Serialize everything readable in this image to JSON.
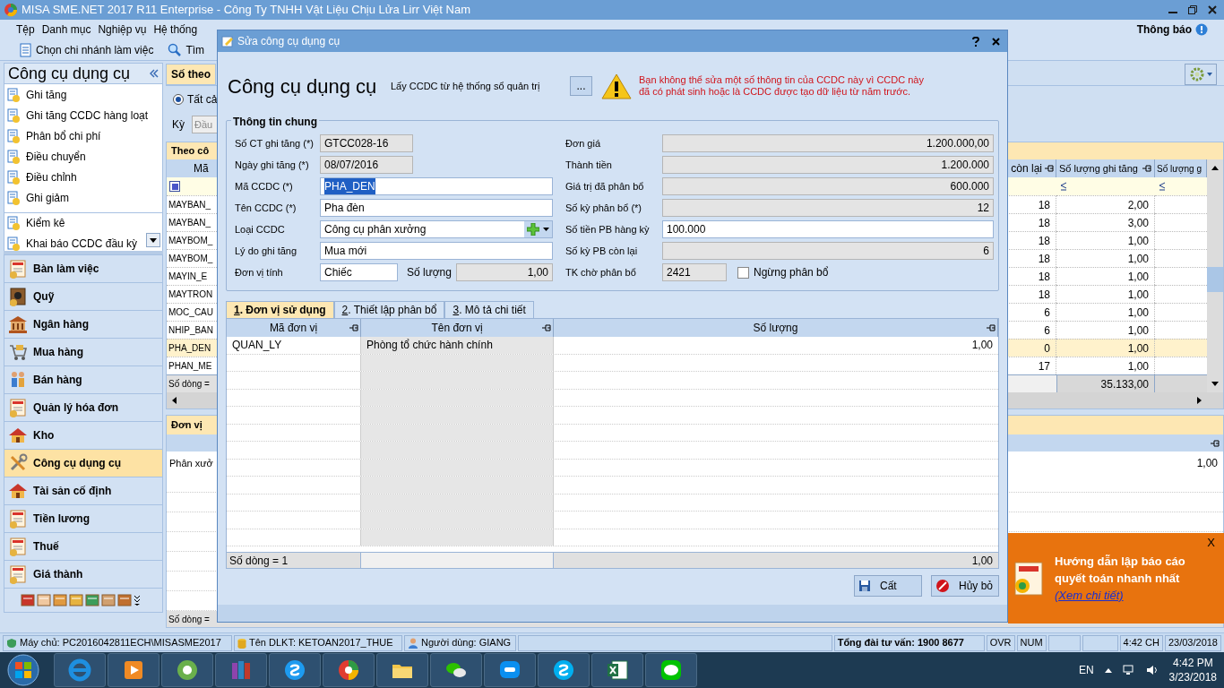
{
  "window": {
    "title": "MISA SME.NET 2017 R11 Enterprise - Công Ty TNHH Vật Liệu Chịu Lửa Lirr Việt Nam"
  },
  "menu": [
    "Tệp",
    "Danh mục",
    "Nghiệp vụ",
    "Hệ thống"
  ],
  "notification_button": "Thông báo",
  "toolbar": [
    {
      "label": "Chọn chi nhánh làm việc",
      "kind": "doc"
    },
    {
      "label": "Tìm",
      "kind": "search"
    }
  ],
  "sidebar": {
    "title": "Công cụ dụng cụ",
    "tasks": [
      {
        "label": "Ghi tăng"
      },
      {
        "label": "Ghi tăng CCDC hàng loạt"
      },
      {
        "label": "Phân bổ chi phí"
      },
      {
        "label": "Điều chuyển"
      },
      {
        "label": "Điều chỉnh"
      },
      {
        "label": "Ghi giảm"
      },
      {
        "label": "Kiểm kê"
      },
      {
        "label": "Khai báo CCDC đầu kỳ"
      }
    ],
    "modules": [
      {
        "label": "Bàn làm việc",
        "kind": "doc",
        "selected": false
      },
      {
        "label": "Quỹ",
        "kind": "safe",
        "selected": false
      },
      {
        "label": "Ngân hàng",
        "kind": "bank",
        "selected": false
      },
      {
        "label": "Mua hàng",
        "kind": "cart",
        "selected": false
      },
      {
        "label": "Bán hàng",
        "kind": "people",
        "selected": false
      },
      {
        "label": "Quản lý hóa đơn",
        "kind": "doc",
        "selected": false
      },
      {
        "label": "Kho",
        "kind": "house",
        "selected": false
      },
      {
        "label": "Công cụ dụng cụ",
        "kind": "tools",
        "selected": true
      },
      {
        "label": "Tài sản cố định",
        "kind": "house",
        "selected": false
      },
      {
        "label": "Tiền lương",
        "kind": "doc",
        "selected": false
      },
      {
        "label": "Thuế",
        "kind": "doc",
        "selected": false
      },
      {
        "label": "Giá thành",
        "kind": "doc",
        "selected": false
      }
    ]
  },
  "main": {
    "tab": "Số theo",
    "radio": {
      "label": "Tất cả",
      "selected": true
    },
    "period_label": "Kỳ",
    "period_value": "Đầu",
    "grid": {
      "group": "Theo cô",
      "filter_checked": true,
      "columns": [
        "Mã",
        "còn lại",
        "Số lượng ghi tăng",
        "Số lượng g"
      ],
      "rows": [
        {
          "code": "MAYBAN_",
          "remaining": "18",
          "qty": "2,00",
          "selected": false
        },
        {
          "code": "MAYBAN_",
          "remaining": "18",
          "qty": "3,00",
          "selected": false
        },
        {
          "code": "MAYBOM_",
          "remaining": "18",
          "qty": "1,00",
          "selected": false
        },
        {
          "code": "MAYBOM_",
          "remaining": "18",
          "qty": "1,00",
          "selected": false
        },
        {
          "code": "MAYIN_E",
          "remaining": "18",
          "qty": "1,00",
          "selected": false
        },
        {
          "code": "MAYTRON",
          "remaining": "18",
          "qty": "1,00",
          "selected": false
        },
        {
          "code": "MOC_CAU",
          "remaining": "6",
          "qty": "1,00",
          "selected": false
        },
        {
          "code": "NHIP_BAN",
          "remaining": "6",
          "qty": "1,00",
          "selected": false
        },
        {
          "code": "PHA_DEN",
          "remaining": "0",
          "qty": "1,00",
          "selected": true
        },
        {
          "code": "PHAN_ME",
          "remaining": "17",
          "qty": "1,00",
          "selected": false
        }
      ],
      "footer": "Số dòng =",
      "total": "35.133,00"
    },
    "units_grid": {
      "group": "Đơn vị",
      "rows": [
        {
          "name": "Phân xưở",
          "qty": "1,00"
        }
      ],
      "footer": "Số dòng ="
    }
  },
  "dialog": {
    "title": "Sửa công cụ dụng cụ",
    "heading": "Công cụ dụng cụ",
    "source_label": "Lấy CCDC từ hệ thống sổ quản trị",
    "browse_button": "...",
    "warning": "Bạn không thể sửa một số thông tin của CCDC này vì CCDC này đã có phát sinh hoặc là CCDC được tạo dữ liệu từ năm trước.",
    "group": "Thông tin chung",
    "left_fields": [
      {
        "label": "Số CT ghi tăng (*)",
        "value": "GTCC028-16",
        "kind": "readonly-short"
      },
      {
        "label": "Ngày ghi tăng (*)",
        "value": "08/07/2016",
        "kind": "readonly-short"
      },
      {
        "label": "Mã CCDC (*)",
        "value": "PHA_DEN",
        "kind": "selected-input"
      },
      {
        "label": "Tên CCDC (*)",
        "value": "Pha đèn",
        "kind": "input"
      },
      {
        "label": "Loại CCDC",
        "value": "Công cụ phân xưởng",
        "kind": "combo"
      },
      {
        "label": "Lý do ghi tăng",
        "value": "Mua mới",
        "kind": "input"
      }
    ],
    "unit": {
      "label": "Đơn vị tính",
      "value": "Chiếc",
      "qty_label": "Số lượng",
      "qty": "1,00"
    },
    "right_fields": [
      {
        "label": "Đơn giá",
        "value": "1.200.000,00",
        "kind": "readonly"
      },
      {
        "label": "Thành tiền",
        "value": "1.200.000",
        "kind": "readonly"
      },
      {
        "label": "Giá trị đã phân bổ",
        "value": "600.000",
        "kind": "readonly"
      },
      {
        "label": "Số kỳ phân bổ (*)",
        "value": "12",
        "kind": "readonly"
      },
      {
        "label": "Số tiền PB hàng kỳ",
        "value": "100.000",
        "kind": "input"
      },
      {
        "label": "Số kỳ PB còn lại",
        "value": "6",
        "kind": "readonly"
      }
    ],
    "account": {
      "label": "TK chờ phân bổ",
      "value": "2421",
      "checkbox": {
        "label": "Ngừng phân bổ",
        "checked": false
      }
    },
    "tabs": [
      {
        "label": "1. Đơn vị sử dụng",
        "selected": true
      },
      {
        "label": "2. Thiết lập phân bổ",
        "selected": false
      },
      {
        "label": "3. Mô tả chi tiết",
        "selected": false
      }
    ],
    "detail": {
      "columns": [
        "Mã đơn vị",
        "Tên đơn vị",
        "Số lượng"
      ],
      "rows": [
        [
          "QUAN_LY",
          "Phòng  tổ chức hành chính",
          "1,00"
        ]
      ],
      "footer": "Số dòng = 1",
      "total": "1,00"
    },
    "buttons": [
      {
        "label": "Cất",
        "kind": "save"
      },
      {
        "label": "Hủy bỏ",
        "kind": "cancel"
      }
    ]
  },
  "popup": {
    "close": "X",
    "title": "Hướng dẫn lập báo cáo quyết toán nhanh nhất",
    "link": "(Xem chi tiết)"
  },
  "status_bar": [
    {
      "text": "Máy chủ: PC2016042811ECH\\MISASME2017",
      "kind": "server"
    },
    {
      "text": "Tên DLKT: KETOAN2017_THUE",
      "kind": "db"
    },
    {
      "text": "Người dùng: GIANG",
      "kind": "user"
    },
    {
      "kind": "blank"
    },
    {
      "text": "Tổng đài tư vấn: 1900 8677",
      "kind": "hotline"
    },
    {
      "text": "OVR",
      "kind": "plain"
    },
    {
      "text": "NUM",
      "kind": "plain"
    },
    {
      "kind": "blank"
    },
    {
      "kind": "blank"
    },
    {
      "text": "4:42 CH",
      "kind": "plain"
    },
    {
      "text": "23/03/2018",
      "kind": "plain"
    }
  ],
  "taskbar": {
    "apps": [
      {
        "kind": "ie"
      },
      {
        "kind": "media"
      },
      {
        "kind": "coccoc"
      },
      {
        "kind": "archive"
      },
      {
        "kind": "skype-s"
      },
      {
        "kind": "misa"
      },
      {
        "kind": "folder"
      },
      {
        "kind": "chat"
      },
      {
        "kind": "zalo"
      },
      {
        "kind": "skype"
      },
      {
        "kind": "excel"
      },
      {
        "kind": "line"
      }
    ],
    "language": "EN",
    "time": "4:42 PM",
    "date": "3/23/2018"
  }
}
